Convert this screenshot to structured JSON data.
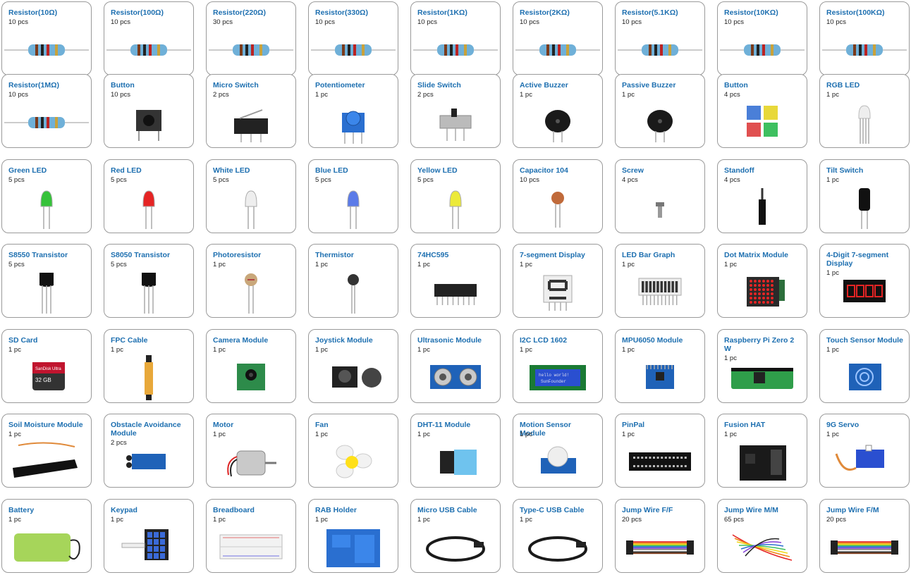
{
  "components": [
    {
      "name": "Resistor(10Ω)",
      "qty": "10 pcs",
      "icon": "resistor-icon"
    },
    {
      "name": "Resistor(100Ω)",
      "qty": "10 pcs",
      "icon": "resistor-icon"
    },
    {
      "name": "Resistor(220Ω)",
      "qty": "30 pcs",
      "icon": "resistor-icon"
    },
    {
      "name": "Resistor(330Ω)",
      "qty": "10 pcs",
      "icon": "resistor-icon"
    },
    {
      "name": "Resistor(1KΩ)",
      "qty": "10 pcs",
      "icon": "resistor-icon"
    },
    {
      "name": "Resistor(2KΩ)",
      "qty": "10 pcs",
      "icon": "resistor-icon"
    },
    {
      "name": "Resistor(5.1KΩ)",
      "qty": "10 pcs",
      "icon": "resistor-icon"
    },
    {
      "name": "Resistor(10KΩ)",
      "qty": "10 pcs",
      "icon": "resistor-icon"
    },
    {
      "name": "Resistor(100KΩ)",
      "qty": "10 pcs",
      "icon": "resistor-icon"
    },
    {
      "name": "Resistor(1MΩ)",
      "qty": "10 pcs",
      "icon": "resistor-icon"
    },
    {
      "name": "Button",
      "qty": "10 pcs",
      "icon": "tactile-button-icon"
    },
    {
      "name": "Micro Switch",
      "qty": "2 pcs",
      "icon": "micro-switch-icon"
    },
    {
      "name": "Potentiometer",
      "qty": "1 pc",
      "icon": "potentiometer-icon"
    },
    {
      "name": "Slide Switch",
      "qty": "2 pcs",
      "icon": "slide-switch-icon"
    },
    {
      "name": "Active Buzzer",
      "qty": "1 pc",
      "icon": "buzzer-icon"
    },
    {
      "name": "Passive Buzzer",
      "qty": "1 pc",
      "icon": "buzzer-icon"
    },
    {
      "name": "Button",
      "qty": "4 pcs",
      "icon": "colored-buttons-icon"
    },
    {
      "name": "RGB LED",
      "qty": "1 pc",
      "icon": "rgb-led-icon"
    },
    {
      "name": "Green LED",
      "qty": "5 pcs",
      "icon": "led-icon",
      "color": "#36c23a"
    },
    {
      "name": "Red LED",
      "qty": "5 pcs",
      "icon": "led-icon",
      "color": "#e52424"
    },
    {
      "name": "White LED",
      "qty": "5 pcs",
      "icon": "led-icon",
      "color": "#eeeeee"
    },
    {
      "name": "Blue LED",
      "qty": "5 pcs",
      "icon": "led-icon",
      "color": "#5b7be8"
    },
    {
      "name": "Yellow LED",
      "qty": "5 pcs",
      "icon": "led-icon",
      "color": "#ecea3a"
    },
    {
      "name": "Capacitor 104",
      "qty": "10 pcs",
      "icon": "capacitor-icon"
    },
    {
      "name": "Screw",
      "qty": "4 pcs",
      "icon": "screw-icon"
    },
    {
      "name": "Standoff",
      "qty": "4 pcs",
      "icon": "standoff-icon"
    },
    {
      "name": "Tilt Switch",
      "qty": "1 pc",
      "icon": "tilt-switch-icon"
    },
    {
      "name": "S8550 Transistor",
      "qty": "5 pcs",
      "icon": "transistor-icon"
    },
    {
      "name": "S8050 Transistor",
      "qty": "5 pcs",
      "icon": "transistor-icon"
    },
    {
      "name": "Photoresistor",
      "qty": "1 pc",
      "icon": "photoresistor-icon"
    },
    {
      "name": "Thermistor",
      "qty": "1 pc",
      "icon": "thermistor-icon"
    },
    {
      "name": "74HC595",
      "qty": "1 pc",
      "icon": "ic-chip-icon"
    },
    {
      "name": "7-segment Display",
      "qty": "1 pc",
      "icon": "seven-segment-icon"
    },
    {
      "name": "LED Bar Graph",
      "qty": "1 pc",
      "icon": "led-bar-graph-icon"
    },
    {
      "name": "Dot Matrix Module",
      "qty": "1 pc",
      "icon": "dot-matrix-icon"
    },
    {
      "name": "4-Digit 7-segment Display",
      "qty": "1 pc",
      "icon": "four-digit-display-icon"
    },
    {
      "name": "SD Card",
      "qty": "1 pc",
      "icon": "sd-card-icon",
      "label": "SanDisk Ultra",
      "label2": "32 GB"
    },
    {
      "name": "FPC Cable",
      "qty": "1 pc",
      "icon": "fpc-cable-icon"
    },
    {
      "name": "Camera Module",
      "qty": "1 pc",
      "icon": "camera-module-icon"
    },
    {
      "name": "Joystick Module",
      "qty": "1 pc",
      "icon": "joystick-icon"
    },
    {
      "name": "Ultrasonic Module",
      "qty": "1 pc",
      "icon": "ultrasonic-icon"
    },
    {
      "name": "I2C LCD 1602",
      "qty": "1 pc",
      "icon": "lcd-icon",
      "label": "hello world!",
      "label2": "SunFounder"
    },
    {
      "name": "MPU6050 Module",
      "qty": "1 pc",
      "icon": "mpu6050-icon"
    },
    {
      "name": "Raspberry Pi Zero 2 W",
      "qty": "1 pc",
      "icon": "raspberry-pi-icon"
    },
    {
      "name": "Touch Sensor Module",
      "qty": "1 pc",
      "icon": "touch-sensor-icon"
    },
    {
      "name": "Soil Moisture Module",
      "qty": "1 pc",
      "icon": "soil-moisture-icon"
    },
    {
      "name": "Obstacle Avoidance Module",
      "qty": "2 pcs",
      "icon": "obstacle-avoidance-icon"
    },
    {
      "name": "Motor",
      "qty": "1 pc",
      "icon": "motor-icon"
    },
    {
      "name": "Fan",
      "qty": "1 pc",
      "icon": "fan-icon"
    },
    {
      "name": "DHT-11 Module",
      "qty": "1 pc",
      "icon": "dht11-icon"
    },
    {
      "name": "Motion Sensor Module",
      "qty": "1 pc",
      "icon": "pir-sensor-icon"
    },
    {
      "name": "PinPal",
      "qty": "1 pc",
      "icon": "pinpal-icon"
    },
    {
      "name": "Fusion HAT",
      "qty": "1 pc",
      "icon": "fusion-hat-icon"
    },
    {
      "name": "9G Servo",
      "qty": "1 pc",
      "icon": "servo-icon"
    },
    {
      "name": "Battery",
      "qty": "1 pc",
      "icon": "battery-icon"
    },
    {
      "name": "Keypad",
      "qty": "1 pc",
      "icon": "keypad-icon"
    },
    {
      "name": "Breadboard",
      "qty": "1 pc",
      "icon": "breadboard-icon"
    },
    {
      "name": "RAB Holder",
      "qty": "1 pc",
      "icon": "rab-holder-icon"
    },
    {
      "name": "Micro USB Cable",
      "qty": "1 pc",
      "icon": "usb-cable-icon"
    },
    {
      "name": "Type-C USB Cable",
      "qty": "1 pc",
      "icon": "usb-cable-icon"
    },
    {
      "name": "Jump Wire F/F",
      "qty": "20 pcs",
      "icon": "jump-wire-icon"
    },
    {
      "name": "Jump Wire M/M",
      "qty": "65 pcs",
      "icon": "jump-wire-bundle-icon"
    },
    {
      "name": "Jump Wire F/M",
      "qty": "20 pcs",
      "icon": "jump-wire-icon"
    }
  ],
  "colors": {
    "title_blue": "#1d6fb0",
    "border_gray": "#9a9a9a",
    "module_blue": "#1f62b8",
    "pcb_black": "#1a1a1a",
    "pi_green": "#2f9e4a"
  }
}
